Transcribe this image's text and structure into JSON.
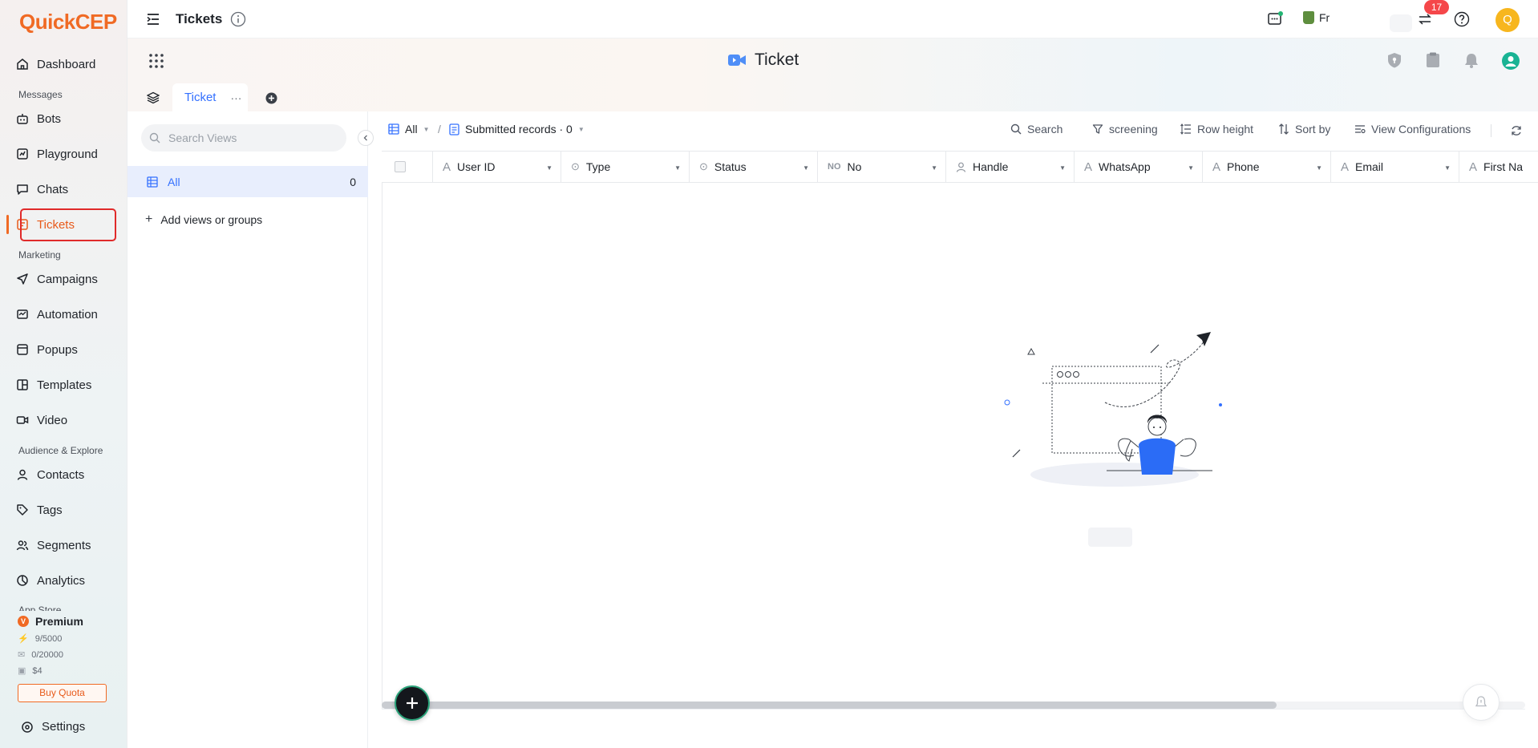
{
  "app": {
    "logo_text": "QuickCEP",
    "page_title": "Tickets",
    "brand_color": "#f06a24",
    "accent_color": "#3370ff"
  },
  "sidebar": {
    "items": [
      {
        "label": "Dashboard",
        "icon": "home-icon"
      },
      {
        "section": "Messages"
      },
      {
        "label": "Bots",
        "icon": "bot-icon"
      },
      {
        "label": "Playground",
        "icon": "playground-icon"
      },
      {
        "label": "Chats",
        "icon": "chat-icon"
      },
      {
        "label": "Tickets",
        "icon": "ticket-icon",
        "active": true
      },
      {
        "section": "Marketing"
      },
      {
        "label": "Campaigns",
        "icon": "send-icon"
      },
      {
        "label": "Automation",
        "icon": "automation-icon"
      },
      {
        "label": "Popups",
        "icon": "popup-icon"
      },
      {
        "label": "Templates",
        "icon": "template-icon"
      },
      {
        "label": "Video",
        "icon": "video-icon"
      },
      {
        "section": "Audience & Explore"
      },
      {
        "label": "Contacts",
        "icon": "user-icon"
      },
      {
        "label": "Tags",
        "icon": "tag-icon"
      },
      {
        "label": "Segments",
        "icon": "segments-icon"
      },
      {
        "label": "Analytics",
        "icon": "analytics-icon"
      },
      {
        "section": "App Store"
      }
    ],
    "premium_label": "Premium",
    "quota_messages": "9/5000",
    "quota_emails": "0/20000",
    "quota_cost": "$4",
    "buy_quota_label": "Buy Quota",
    "settings_label": "Settings"
  },
  "topbar": {
    "store_label": "Fr",
    "notification_count": "17",
    "avatar_letter": "Q"
  },
  "band": {
    "title": "Ticket",
    "tab_label": "Ticket",
    "tab_more": "···"
  },
  "views": {
    "search_placeholder": "Search Views",
    "all_label": "All",
    "all_count": "0",
    "add_label": "Add views or groups"
  },
  "toolbar": {
    "view_label": "All",
    "separator": "/",
    "records_label": "Submitted records · 0",
    "search_label": "Search",
    "screening_label": "screening",
    "row_height_label": "Row height",
    "sort_label": "Sort by",
    "view_config_label": "View Configurations"
  },
  "table": {
    "columns": [
      {
        "label": "User ID",
        "icon": "text-field-icon"
      },
      {
        "label": "Type",
        "icon": "single-select-icon"
      },
      {
        "label": "Status",
        "icon": "single-select-icon"
      },
      {
        "label": "No",
        "icon": "autonumber-icon"
      },
      {
        "label": "Handle",
        "icon": "person-field-icon"
      },
      {
        "label": "WhatsApp",
        "icon": "text-field-icon"
      },
      {
        "label": "Phone",
        "icon": "text-field-icon"
      },
      {
        "label": "Email",
        "icon": "text-field-icon"
      },
      {
        "label": "First Na",
        "icon": "text-field-icon"
      }
    ]
  }
}
